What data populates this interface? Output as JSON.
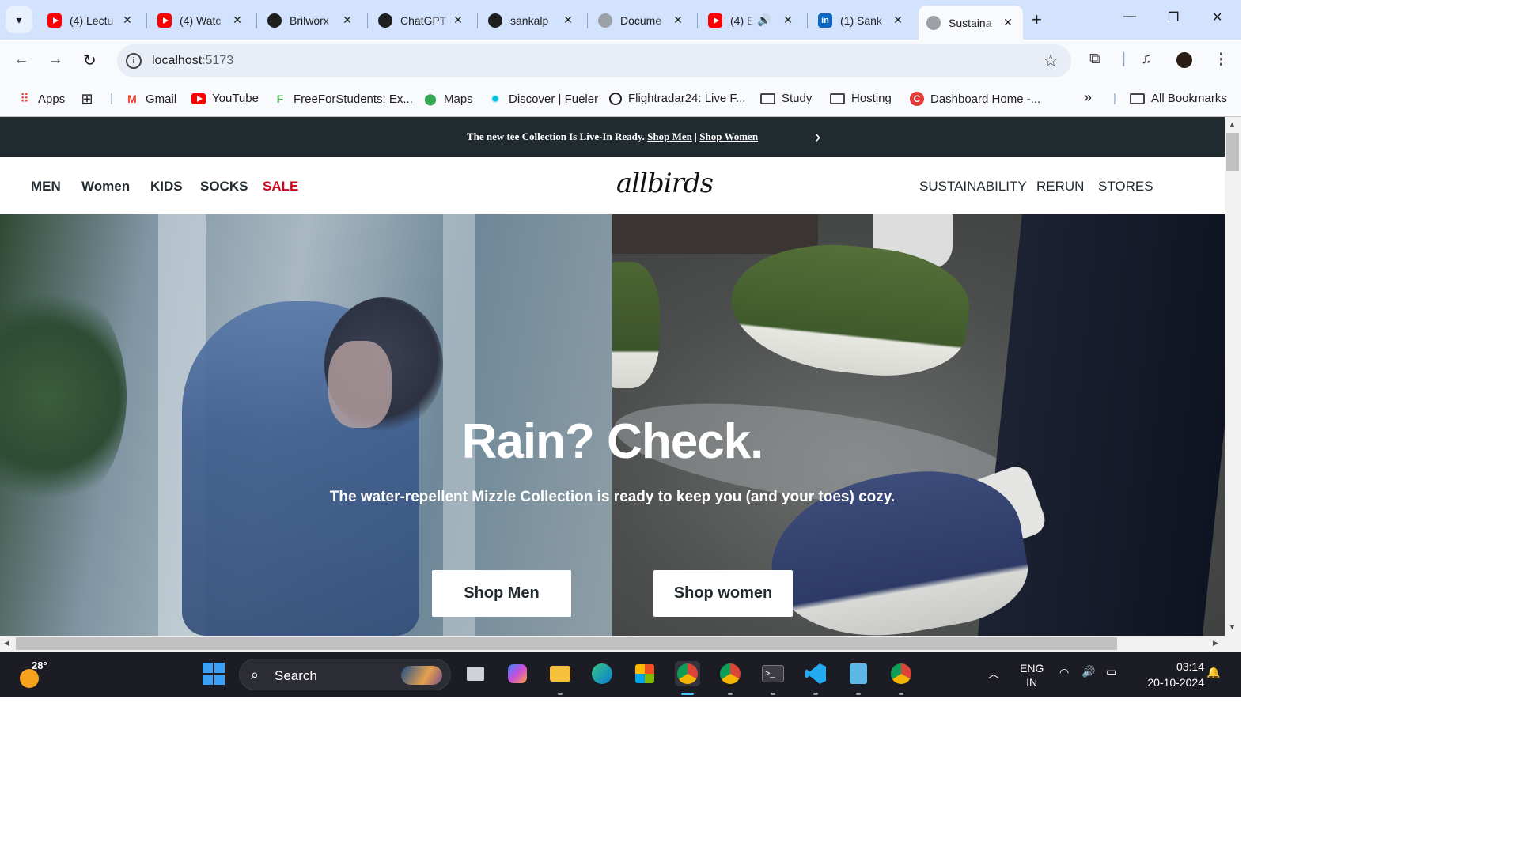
{
  "browser": {
    "tabs": [
      {
        "title": "(4) Lectu",
        "favicon": "youtube-icon",
        "audio": false
      },
      {
        "title": "(4) Watc",
        "favicon": "youtube-icon",
        "audio": false
      },
      {
        "title": "Brilworx",
        "favicon": "github-icon",
        "audio": false
      },
      {
        "title": "ChatGPT",
        "favicon": "chatgpt-icon",
        "audio": false
      },
      {
        "title": "sankalp",
        "favicon": "github-icon",
        "audio": false
      },
      {
        "title": "Docume",
        "favicon": "globe-icon",
        "audio": false
      },
      {
        "title": "(4) E",
        "favicon": "youtube-icon",
        "audio": true
      },
      {
        "title": "(1) Sank",
        "favicon": "linkedin-icon",
        "audio": false
      },
      {
        "title": "Sustaina",
        "favicon": "globe-icon",
        "audio": false,
        "active": true
      }
    ],
    "url": {
      "host": "localhost",
      "port": ":5173"
    },
    "bookmarks": [
      {
        "label": "Apps",
        "icon": "apps-grid-icon"
      },
      {
        "label": "",
        "icon": "tab-groups-icon"
      },
      {
        "label": "Gmail",
        "icon": "gmail-icon"
      },
      {
        "label": "YouTube",
        "icon": "youtube-icon"
      },
      {
        "label": "FreeForStudents: Ex...",
        "icon": "freeforstudents-icon"
      },
      {
        "label": "Maps",
        "icon": "maps-pin-icon"
      },
      {
        "label": "Discover | Fueler",
        "icon": "fueler-icon"
      },
      {
        "label": "Flightradar24: Live F...",
        "icon": "flightradar-icon"
      },
      {
        "label": "Study",
        "icon": "folder-icon"
      },
      {
        "label": "Hosting",
        "icon": "folder-icon"
      },
      {
        "label": "Dashboard Home -...",
        "icon": "dashboard-icon"
      },
      {
        "label": "All Bookmarks",
        "icon": "folder-icon"
      }
    ],
    "overflow_label": "»"
  },
  "site": {
    "announcement": {
      "text": "The new tee Collection Is Live-In Ready.",
      "link_men": "Shop Men",
      "separator": "|",
      "link_women": "Shop Women"
    },
    "nav_left": [
      "MEN",
      "Women",
      "KIDS",
      "SOCKS",
      "SALE"
    ],
    "logo": "allbirds",
    "nav_right": [
      "SUSTAINABILITY",
      "RERUN",
      "STORES"
    ],
    "hero": {
      "title": "Rain? Check.",
      "subtitle": "The water-repellent Mizzle Collection is ready to keep you (and your toes) cozy.",
      "btn_men": "Shop Men",
      "btn_women": "Shop women"
    },
    "colors": {
      "announce_bg": "#212a2f",
      "sale": "#d0021b",
      "text": "#212a2f"
    }
  },
  "taskbar": {
    "weather_temp": "28°",
    "search_label": "Search",
    "lang": "ENG",
    "region": "IN",
    "time": "03:14",
    "date": "20-10-2024"
  }
}
